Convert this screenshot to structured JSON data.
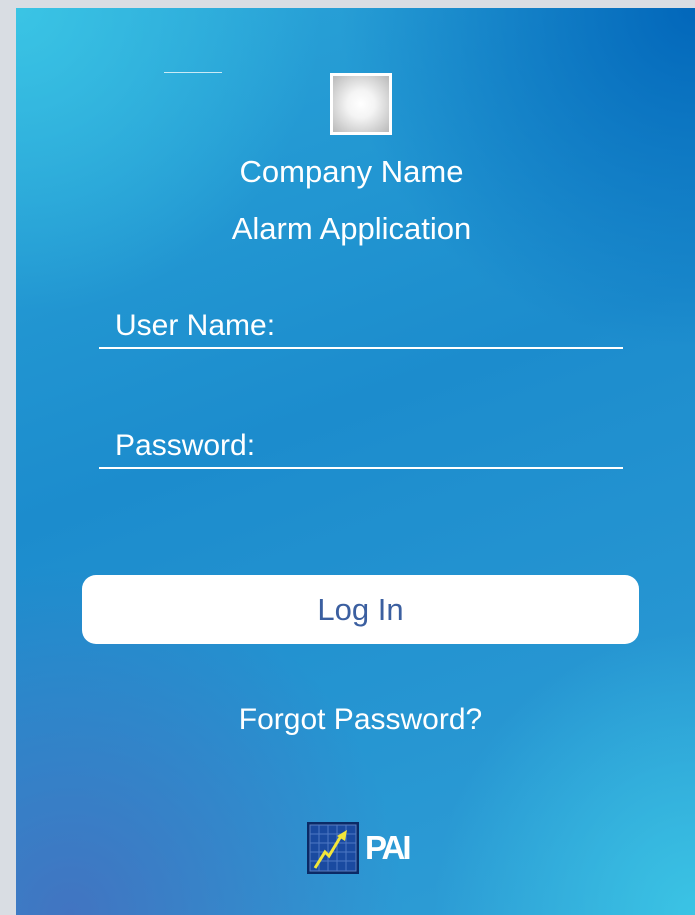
{
  "header": {
    "company_name": "Company Name",
    "app_name": "Alarm Application",
    "logo_icon": "placeholder-logo-icon"
  },
  "login_form": {
    "username_label": "User Name:",
    "username_value": "",
    "password_label": "Password:",
    "password_value": "",
    "login_button_label": "Log In",
    "forgot_password_label": "Forgot Password?"
  },
  "footer": {
    "brand_icon": "pai-chart-icon",
    "brand_text": "PAI"
  },
  "colors": {
    "background_top_left": "#3cc8e6",
    "background_top_right": "#0064b9",
    "background_bottom_left": "#466ebe",
    "background_bottom_right": "#3cc8e6",
    "text": "#ffffff",
    "button_background": "#ffffff",
    "button_text": "#3b5fa0"
  }
}
